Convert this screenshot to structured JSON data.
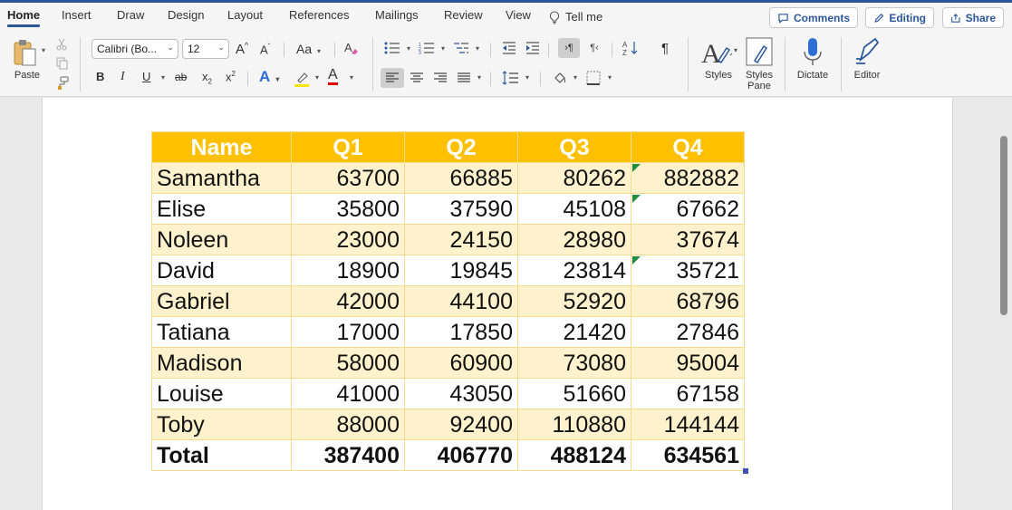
{
  "ribbon_tabs": [
    "Home",
    "Insert",
    "Draw",
    "Design",
    "Layout",
    "References",
    "Mailings",
    "Review",
    "View"
  ],
  "active_tab": "Home",
  "tell_me": "Tell me",
  "header_buttons": {
    "comments": "Comments",
    "editing": "Editing",
    "share": "Share"
  },
  "ribbon": {
    "paste_label": "Paste",
    "font_name": "Calibri (Bo...",
    "font_size": "12",
    "case_label": "Aa",
    "styles_label": "Styles",
    "styles_pane_label": "Styles\nPane",
    "styles_pane_line1": "Styles",
    "styles_pane_line2": "Pane",
    "dictate_label": "Dictate",
    "editor_label": "Editor",
    "bold": "B",
    "italic": "I",
    "underline": "U",
    "strike": "ab",
    "subscript": "x",
    "superscript": "x",
    "sub_mark": "2",
    "sup_mark": "2",
    "grow_font": "A",
    "shrink_font": "A",
    "text_effects": "A",
    "font_color": "A",
    "pilcrow": "¶"
  },
  "colors": {
    "accent": "#2b579a",
    "header_fill": "#ffc000",
    "band_fill": "#fff2cc",
    "highlight_yellow": "#ffe600",
    "font_red": "#e00000",
    "error_flag": "#1e8e3e"
  },
  "table": {
    "headers": [
      "Name",
      "Q1",
      "Q2",
      "Q3",
      "Q4"
    ],
    "rows": [
      {
        "name": "Samantha",
        "q1": "63700",
        "q2": "66885",
        "q3": "80262",
        "q4": "882882",
        "flag": true
      },
      {
        "name": "Elise",
        "q1": "35800",
        "q2": "37590",
        "q3": "45108",
        "q4": "67662",
        "flag": true
      },
      {
        "name": "Noleen",
        "q1": "23000",
        "q2": "24150",
        "q3": "28980",
        "q4": "37674",
        "flag": false
      },
      {
        "name": "David",
        "q1": "18900",
        "q2": "19845",
        "q3": "23814",
        "q4": "35721",
        "flag": true
      },
      {
        "name": "Gabriel",
        "q1": "42000",
        "q2": "44100",
        "q3": "52920",
        "q4": "68796",
        "flag": false
      },
      {
        "name": "Tatiana",
        "q1": "17000",
        "q2": "17850",
        "q3": "21420",
        "q4": "27846",
        "flag": false
      },
      {
        "name": "Madison",
        "q1": "58000",
        "q2": "60900",
        "q3": "73080",
        "q4": "95004",
        "flag": false
      },
      {
        "name": "Louise",
        "q1": "41000",
        "q2": "43050",
        "q3": "51660",
        "q4": "67158",
        "flag": false
      },
      {
        "name": "Toby",
        "q1": "88000",
        "q2": "92400",
        "q3": "110880",
        "q4": "144144",
        "flag": false
      }
    ],
    "total": {
      "name": "Total",
      "q1": "387400",
      "q2": "406770",
      "q3": "488124",
      "q4": "634561"
    }
  }
}
